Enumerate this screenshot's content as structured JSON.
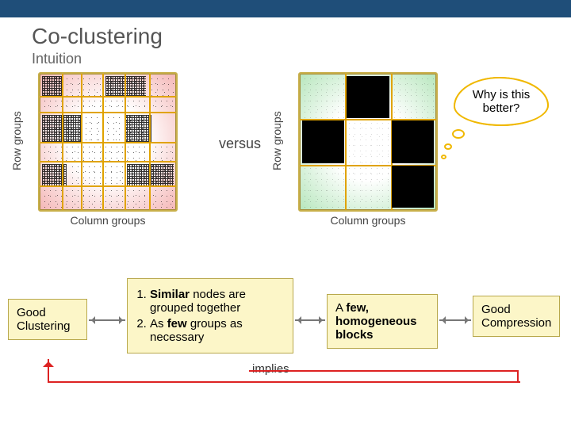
{
  "title": "Co-clustering",
  "subtitle": "Intuition",
  "axis_row_label": "Row groups",
  "axis_col_label": "Column groups",
  "versus": "versus",
  "thought": "Why is this better?",
  "box_good_clustering": "Good Clustering",
  "box_good_compression": "Good Compression",
  "box_criteria": {
    "item1_prefix": "Similar",
    "item1_rest": " nodes are grouped together",
    "item2_prefix": "As ",
    "item2_strong": "few",
    "item2_rest": " groups as necessary"
  },
  "box_few": {
    "line1_prefix": "A ",
    "line1_strong": "few,",
    "line2_strong": "homogeneous blocks"
  },
  "implies": "implies",
  "left_matrix": {
    "rows": 6,
    "cols": 6,
    "note": "noisy permuted adjacency matrix with 6x6 co-cluster grid"
  },
  "right_matrix": {
    "rows": 3,
    "cols": 3,
    "dense_blocks": [
      [
        0,
        1
      ],
      [
        1,
        0
      ],
      [
        1,
        2
      ],
      [
        2,
        2
      ]
    ],
    "note": "clean block matrix with 4 dense black blocks"
  }
}
